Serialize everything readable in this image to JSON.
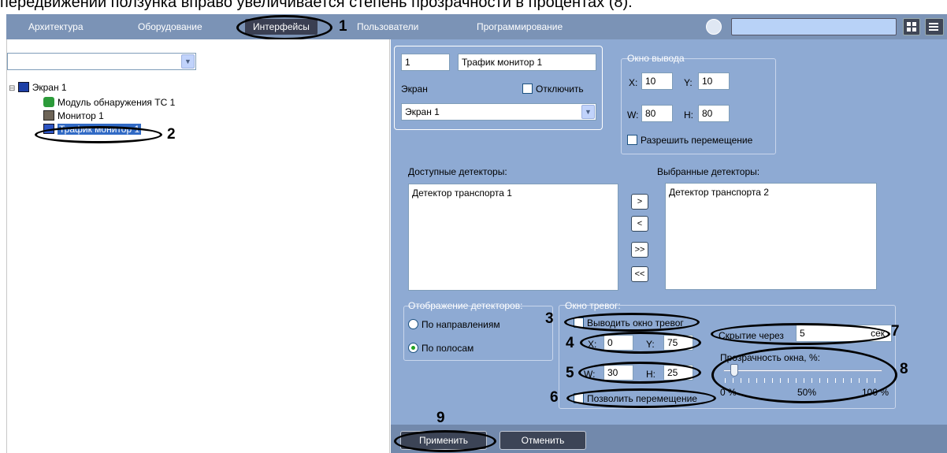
{
  "caption": "передвижении ползунка вправо увеличивается степень прозрачности в процентах (8).",
  "nav": {
    "tabs": [
      "Архитектура",
      "Оборудование",
      "Интерфейсы",
      "Пользователи",
      "Программирование"
    ],
    "active_index": 2,
    "search_value": ""
  },
  "callouts": [
    "1",
    "2",
    "3",
    "4",
    "5",
    "6",
    "7",
    "8",
    "9"
  ],
  "left": {
    "combo_value": "",
    "tree": [
      {
        "label": "Экран 1",
        "expander": "⊟"
      },
      {
        "label": "Модуль обнаружения ТС 1"
      },
      {
        "label": "Монитор 1"
      },
      {
        "label": "Трафик монитор 1",
        "selected": true
      }
    ]
  },
  "object": {
    "id": "1",
    "name": "Трафик монитор 1",
    "screen_label": "Экран",
    "disable_label": "Отключить",
    "screen_value": "Экран 1"
  },
  "output_window": {
    "title": "Окно вывода",
    "x_label": "X:",
    "x": "10",
    "y_label": "Y:",
    "y": "10",
    "w_label": "W:",
    "w": "80",
    "h_label": "H:",
    "h": "80",
    "allow_move_label": "Разрешить перемещение"
  },
  "detectors": {
    "available_label": "Доступные детекторы:",
    "selected_label": "Выбранные детекторы:",
    "available": [
      "Детектор транспорта 1"
    ],
    "selected": [
      "Детектор транспорта 2"
    ],
    "btn_add": ">",
    "btn_remove": "<",
    "btn_add_all": ">>",
    "btn_remove_all": "<<"
  },
  "display": {
    "title": "Отображение детекторов:",
    "by_direction": "По направлениям",
    "by_lane": "По полосам",
    "selected": "by_lane"
  },
  "alarm_window": {
    "title": "Окно тревог:",
    "show_label": "Выводить окно тревог",
    "x_label": "X:",
    "x": "0",
    "y_label": "Y:",
    "y": "75",
    "w_label": "W:",
    "w": "30",
    "h_label": "H:",
    "h": "25",
    "allow_move_label": "Позволить перемещение",
    "hide_label": "Скрытие через",
    "hide_value": "5",
    "hide_unit": "сек",
    "opacity_label": "Прозрачность окна, %:",
    "opacity_value": 0.1,
    "tick_0": "0 %",
    "tick_50": "50%",
    "tick_100": "100 %"
  },
  "buttons": {
    "apply": "Применить",
    "cancel": "Отменить"
  },
  "colors": {
    "topbar": "#7b93b6",
    "panel": "#8eaad3",
    "active_tab": "#3a3f52"
  }
}
